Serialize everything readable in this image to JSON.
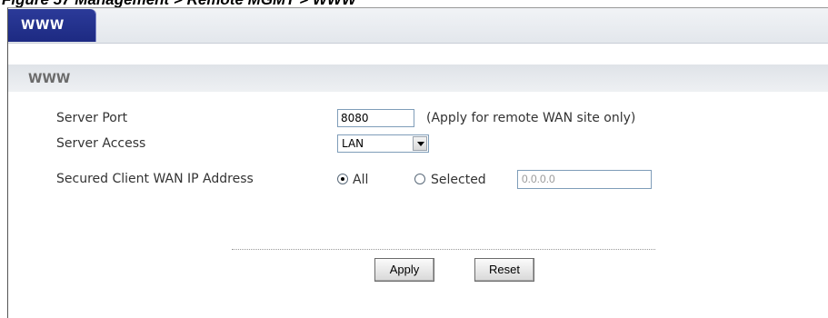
{
  "caption": "Figure 57 Management > Remote MGMT > WWW",
  "tab": {
    "label": "WWW"
  },
  "section": {
    "title": "WWW"
  },
  "form": {
    "server_port": {
      "label": "Server Port",
      "value": "8080",
      "hint": "(Apply for remote WAN site only)"
    },
    "server_access": {
      "label": "Server Access",
      "selected": "LAN"
    },
    "secured_client": {
      "label": "Secured Client WAN IP Address",
      "option_all": "All",
      "option_selected": "Selected",
      "selected_option": "All",
      "ip_value": "0.0.0.0"
    }
  },
  "buttons": {
    "apply": "Apply",
    "reset": "Reset"
  }
}
